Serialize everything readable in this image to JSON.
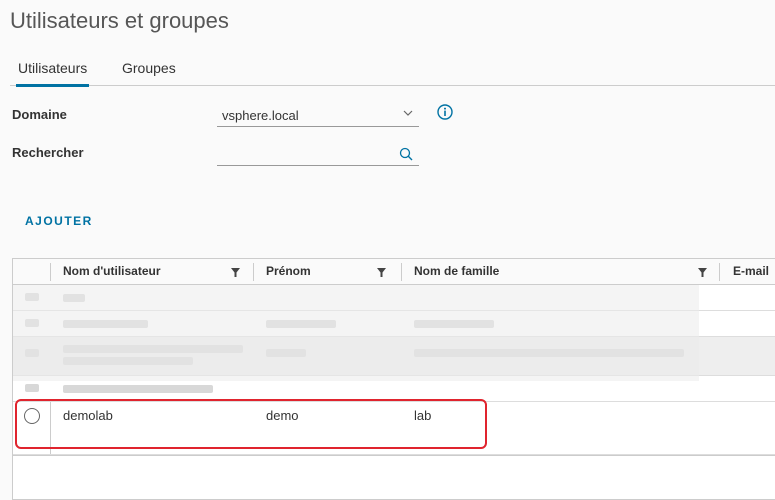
{
  "page": {
    "title": "Utilisateurs et groupes"
  },
  "tabs": [
    {
      "label": "Utilisateurs",
      "active": true
    },
    {
      "label": "Groupes",
      "active": false
    }
  ],
  "form": {
    "domain_label": "Domaine",
    "domain_value": "vsphere.local",
    "search_label": "Rechercher",
    "search_value": ""
  },
  "actions": {
    "add_label": "AJOUTER"
  },
  "table": {
    "columns": [
      "Nom d'utilisateur",
      "Prénom",
      "Nom de famille",
      "E-mail"
    ],
    "visible_row": {
      "username": "demolab",
      "first_name": "demo",
      "last_name": "lab"
    }
  },
  "colors": {
    "accent": "#0072a3",
    "highlight": "#e0242e"
  }
}
